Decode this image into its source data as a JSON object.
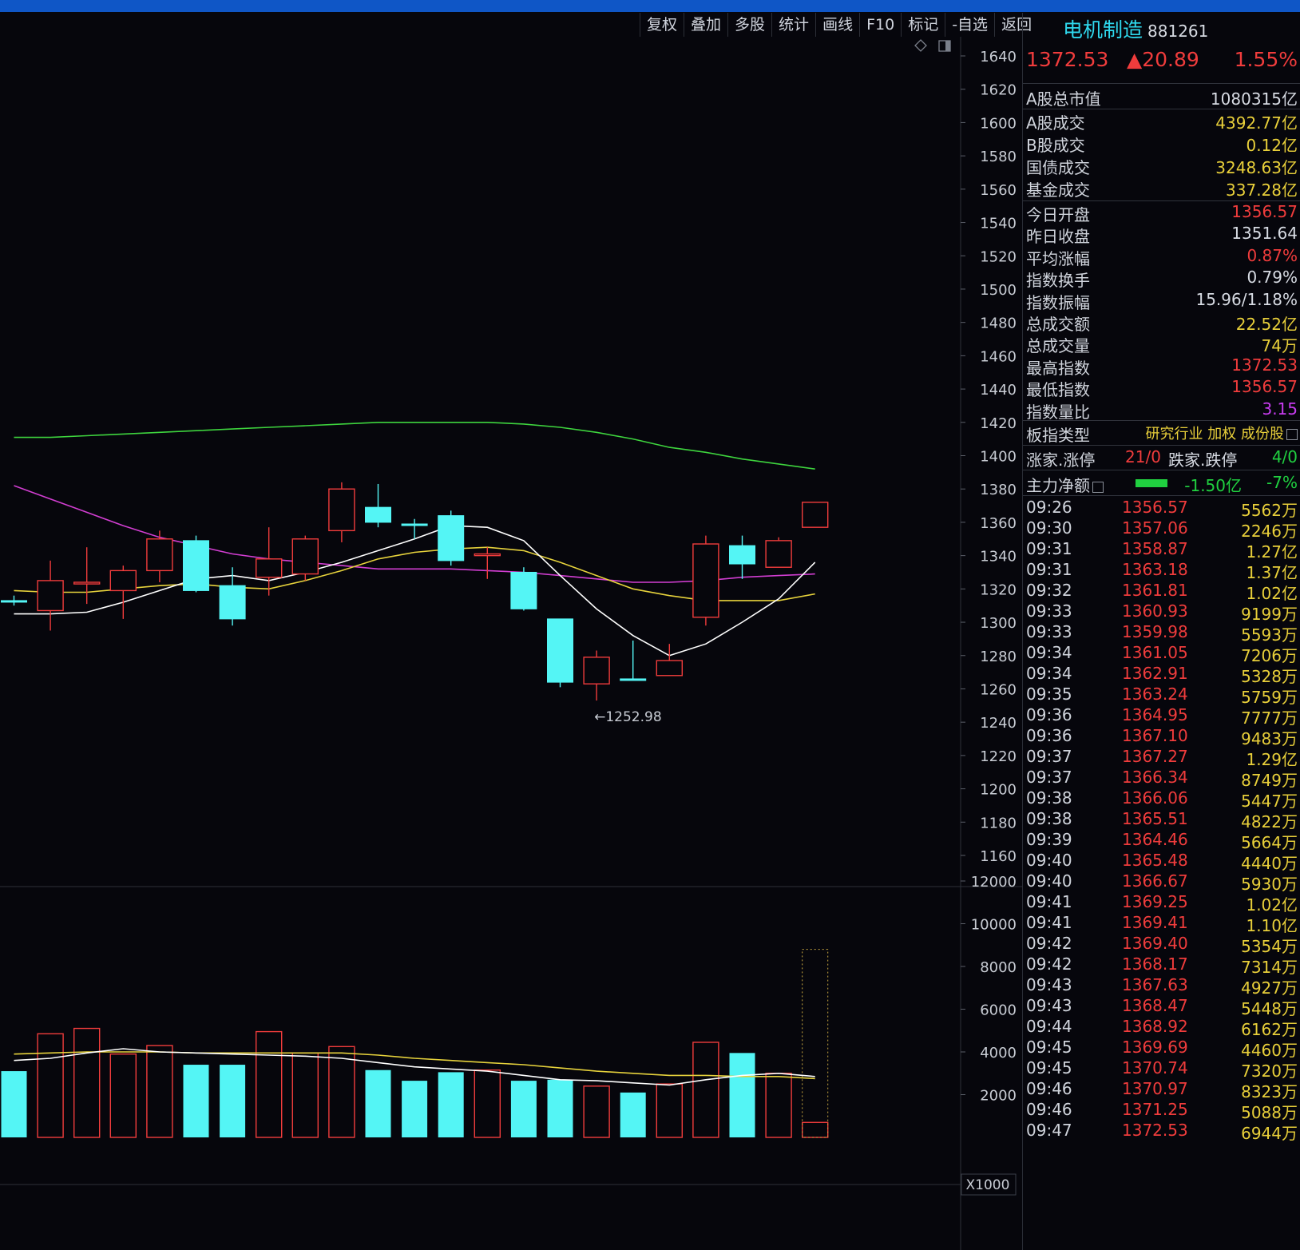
{
  "toolbar": {
    "items": [
      "复权",
      "叠加",
      "多股",
      "统计",
      "画线",
      "F10",
      "标记",
      "-自选",
      "返回"
    ]
  },
  "index": {
    "name": "电机制造",
    "code": "881261",
    "price": "1372.53",
    "change": "▲20.89",
    "pct": "1.55%"
  },
  "market": {
    "total_cap_label": "A股总市值",
    "total_cap": "1080315亿",
    "rows": [
      {
        "k": "A股成交",
        "v": "4392.77亿"
      },
      {
        "k": "B股成交",
        "v": "0.12亿"
      },
      {
        "k": "国债成交",
        "v": "3248.63亿"
      },
      {
        "k": "基金成交",
        "v": "337.28亿"
      }
    ]
  },
  "stats": [
    {
      "k": "今日开盘",
      "v": "1356.57",
      "c": "red"
    },
    {
      "k": "昨日收盘",
      "v": "1351.64",
      "c": "wht"
    },
    {
      "k": "平均涨幅",
      "v": "0.87%",
      "c": "red"
    },
    {
      "k": "指数换手",
      "v": "0.79%",
      "c": "wht"
    },
    {
      "k": "指数振幅",
      "v": "15.96/1.18%",
      "c": "wht"
    },
    {
      "k": "总成交额",
      "v": "22.52亿",
      "c": "yel"
    },
    {
      "k": "总成交量",
      "v": "74万",
      "c": "yel"
    },
    {
      "k": "最高指数",
      "v": "1372.53",
      "c": "red"
    },
    {
      "k": "最低指数",
      "v": "1356.57",
      "c": "red"
    },
    {
      "k": "指数量比",
      "v": "3.15",
      "c": "mag"
    }
  ],
  "board": {
    "label": "板指类型",
    "value": "研究行业 加权 成份股"
  },
  "limits": {
    "up_label": "涨家.涨停",
    "up_value": "21/0",
    "down_label": "跌家.跌停",
    "down_value": "4/0"
  },
  "flow": {
    "label": "主力净额",
    "value": "-1.50亿",
    "pct": "-7%"
  },
  "ticks": [
    [
      "09:26",
      "1356.57",
      "5562万"
    ],
    [
      "09:30",
      "1357.06",
      "2246万"
    ],
    [
      "09:31",
      "1358.87",
      "1.27亿"
    ],
    [
      "09:31",
      "1363.18",
      "1.37亿"
    ],
    [
      "09:32",
      "1361.81",
      "1.02亿"
    ],
    [
      "09:33",
      "1360.93",
      "9199万"
    ],
    [
      "09:33",
      "1359.98",
      "5593万"
    ],
    [
      "09:34",
      "1361.05",
      "7206万"
    ],
    [
      "09:34",
      "1362.91",
      "5328万"
    ],
    [
      "09:35",
      "1363.24",
      "5759万"
    ],
    [
      "09:36",
      "1364.95",
      "7777万"
    ],
    [
      "09:36",
      "1367.10",
      "9483万"
    ],
    [
      "09:37",
      "1367.27",
      "1.29亿"
    ],
    [
      "09:37",
      "1366.34",
      "8749万"
    ],
    [
      "09:38",
      "1366.06",
      "5447万"
    ],
    [
      "09:38",
      "1365.51",
      "4822万"
    ],
    [
      "09:39",
      "1364.46",
      "5664万"
    ],
    [
      "09:40",
      "1365.48",
      "4440万"
    ],
    [
      "09:40",
      "1366.67",
      "5930万"
    ],
    [
      "09:41",
      "1369.25",
      "1.02亿"
    ],
    [
      "09:41",
      "1369.41",
      "1.10亿"
    ],
    [
      "09:42",
      "1369.40",
      "5354万"
    ],
    [
      "09:42",
      "1368.17",
      "7314万"
    ],
    [
      "09:43",
      "1367.63",
      "4927万"
    ],
    [
      "09:43",
      "1368.47",
      "5448万"
    ],
    [
      "09:44",
      "1368.92",
      "6162万"
    ],
    [
      "09:45",
      "1369.69",
      "4460万"
    ],
    [
      "09:45",
      "1370.74",
      "7320万"
    ],
    [
      "09:46",
      "1370.97",
      "8323万"
    ],
    [
      "09:46",
      "1371.25",
      "5088万"
    ],
    [
      "09:47",
      "1372.53",
      "6944万"
    ]
  ],
  "chart_data": {
    "type": "candlestick",
    "price_axis": {
      "ticks": [
        1640,
        1620,
        1600,
        1580,
        1560,
        1540,
        1520,
        1500,
        1480,
        1460,
        1440,
        1420,
        1400,
        1380,
        1360,
        1340,
        1320,
        1300,
        1280,
        1260,
        1240,
        1220,
        1200,
        1180,
        1160
      ]
    },
    "volume_axis": {
      "ticks": [
        12000,
        10000,
        8000,
        6000,
        4000,
        2000
      ],
      "unit": "X1000"
    },
    "low_annotation": "←1252.98",
    "colors": {
      "up": "#f03c3c",
      "down": "#54f5f5",
      "ma5": "#ffffff",
      "ma10": "#e6d23c",
      "ma20": "#d23ed2",
      "ma60": "#3ed43e"
    },
    "candles": [
      {
        "o": 1313,
        "c": 1313,
        "h": 1316,
        "l": 1310,
        "vol": 3100,
        "up": false
      },
      {
        "o": 1307,
        "c": 1325,
        "h": 1337,
        "l": 1295,
        "vol": 4850,
        "up": true
      },
      {
        "o": 1324,
        "c": 1323,
        "h": 1345,
        "l": 1311,
        "vol": 5100,
        "up": true
      },
      {
        "o": 1319,
        "c": 1331,
        "h": 1334,
        "l": 1302,
        "vol": 3900,
        "up": true
      },
      {
        "o": 1331,
        "c": 1350,
        "h": 1355,
        "l": 1324,
        "vol": 4300,
        "up": true
      },
      {
        "o": 1349,
        "c": 1319,
        "h": 1352,
        "l": 1318,
        "vol": 3400,
        "up": false
      },
      {
        "o": 1322,
        "c": 1302,
        "h": 1333,
        "l": 1298,
        "vol": 3400,
        "up": false
      },
      {
        "o": 1327,
        "c": 1338,
        "h": 1357,
        "l": 1316,
        "vol": 4950,
        "up": true
      },
      {
        "o": 1329,
        "c": 1350,
        "h": 1352,
        "l": 1325,
        "vol": 3950,
        "up": true
      },
      {
        "o": 1355,
        "c": 1380,
        "h": 1384,
        "l": 1348,
        "vol": 4250,
        "up": true
      },
      {
        "o": 1369,
        "c": 1360,
        "h": 1383,
        "l": 1357,
        "vol": 3150,
        "up": false
      },
      {
        "o": 1359,
        "c": 1359,
        "h": 1362,
        "l": 1350,
        "vol": 2650,
        "up": false
      },
      {
        "o": 1364,
        "c": 1337,
        "h": 1367,
        "l": 1334,
        "vol": 3050,
        "up": false
      },
      {
        "o": 1340,
        "c": 1341,
        "h": 1345,
        "l": 1326,
        "vol": 3150,
        "up": true
      },
      {
        "o": 1330,
        "c": 1308,
        "h": 1333,
        "l": 1307,
        "vol": 2650,
        "up": false
      },
      {
        "o": 1302,
        "c": 1264,
        "h": 1302,
        "l": 1261,
        "vol": 2700,
        "up": false
      },
      {
        "o": 1263,
        "c": 1279,
        "h": 1283,
        "l": 1253,
        "vol": 2400,
        "up": true
      },
      {
        "o": 1266,
        "c": 1266,
        "h": 1289,
        "l": 1265,
        "vol": 2100,
        "up": false
      },
      {
        "o": 1268,
        "c": 1277,
        "h": 1287,
        "l": 1268,
        "vol": 2500,
        "up": true
      },
      {
        "o": 1303,
        "c": 1347,
        "h": 1352,
        "l": 1298,
        "vol": 4450,
        "up": true
      },
      {
        "o": 1346,
        "c": 1335,
        "h": 1352,
        "l": 1326,
        "vol": 3950,
        "up": false
      },
      {
        "o": 1333,
        "c": 1349,
        "h": 1351,
        "l": 1333,
        "vol": 3000,
        "up": true
      },
      {
        "o": 1357,
        "c": 1372,
        "h": 1372,
        "l": 1357,
        "vol": 700,
        "up": true
      }
    ],
    "ma5": [
      1305,
      1305,
      1306,
      1312,
      1319,
      1326,
      1328,
      1325,
      1330,
      1336,
      1343,
      1350,
      1358,
      1357,
      1349,
      1328,
      1308,
      1292,
      1280,
      1287,
      1300,
      1314,
      1336
    ],
    "ma10": [
      1319,
      1318,
      1318,
      1320,
      1322,
      1323,
      1321,
      1320,
      1325,
      1331,
      1338,
      1342,
      1344,
      1345,
      1343,
      1336,
      1328,
      1320,
      1316,
      1313,
      1313,
      1313,
      1317
    ],
    "ma20": [
      1382,
      1374,
      1366,
      1358,
      1351,
      1346,
      1341,
      1338,
      1336,
      1334,
      1332,
      1332,
      1332,
      1331,
      1330,
      1328,
      1326,
      1324,
      1324,
      1325,
      1327,
      1328,
      1329
    ],
    "ma60": [
      1411,
      1411,
      1412,
      1413,
      1414,
      1415,
      1416,
      1417,
      1418,
      1419,
      1420,
      1420,
      1420,
      1420,
      1419,
      1417,
      1414,
      1410,
      1405,
      1402,
      1398,
      1395,
      1392
    ],
    "vol_ma5": [
      3600,
      3700,
      3950,
      4150,
      4000,
      3950,
      3900,
      3850,
      3800,
      3700,
      3500,
      3300,
      3200,
      3100,
      2900,
      2700,
      2650,
      2550,
      2450,
      2700,
      2900,
      3000,
      2850
    ],
    "vol_ma10": [
      3900,
      3950,
      4000,
      4000,
      4000,
      3950,
      3950,
      3950,
      3950,
      3950,
      3850,
      3700,
      3600,
      3500,
      3400,
      3250,
      3100,
      3000,
      2900,
      2900,
      2850,
      2850,
      2750
    ]
  }
}
